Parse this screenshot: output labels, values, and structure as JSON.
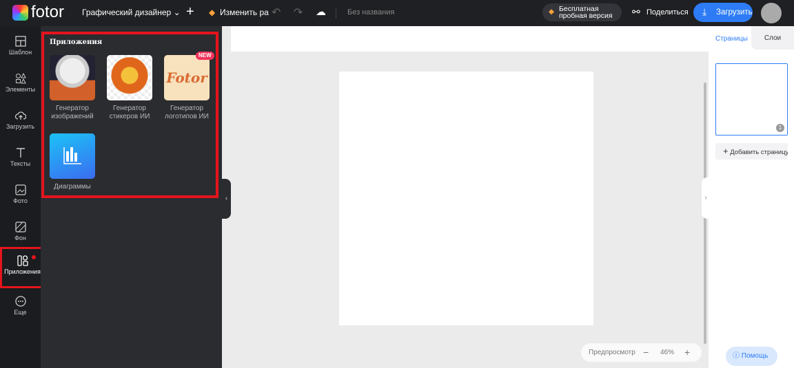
{
  "topbar": {
    "logo": "fotor",
    "mode": "Графический дизайнер",
    "edit": "Изменить ра",
    "doc_title": "Без названия",
    "trial": [
      "Бесплатная",
      "пробная версия"
    ],
    "share": "Поделиться",
    "download": "Загрузить"
  },
  "sidebar": {
    "items": [
      {
        "label": "Шаблон"
      },
      {
        "label": "Элементы"
      },
      {
        "label": "Загрузить"
      },
      {
        "label": "Тексты"
      },
      {
        "label": "Фото"
      },
      {
        "label": "Фон"
      },
      {
        "label": "Приложения"
      },
      {
        "label": "Еще"
      }
    ]
  },
  "panel": {
    "title": "Приложения",
    "apps": [
      {
        "label": [
          "Генератор",
          "изображений"
        ]
      },
      {
        "label": [
          "Генератор",
          "стикеров ИИ"
        ]
      },
      {
        "label": [
          "Генератор",
          "логотипов ИИ"
        ],
        "badge": "NEW",
        "logo_text": "Fotor"
      },
      {
        "label": [
          "Диаграммы"
        ]
      }
    ]
  },
  "right": {
    "tabs": [
      "Страницы",
      "Слои"
    ],
    "page_number": "1",
    "add_page": "Добавить страницу"
  },
  "zoom": {
    "preview": "Предпросмотр",
    "value": "46%"
  },
  "help": "Помощь",
  "colors": {
    "accent": "#2d7cf6",
    "highlight": "#e5141c"
  }
}
